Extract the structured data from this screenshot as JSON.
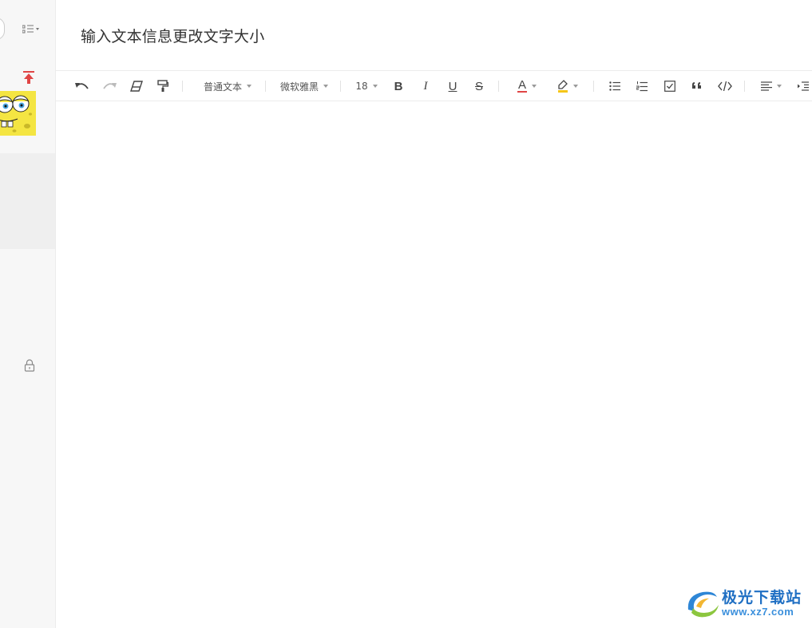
{
  "editor": {
    "title": "输入文本信息更改文字大小"
  },
  "toolbar": {
    "paragraph_style": "普通文本",
    "font_family": "微软雅黑",
    "font_size": "18",
    "bold_label": "B",
    "italic_label": "I",
    "underline_label": "U",
    "strike_label": "S",
    "font_color_label": "A",
    "font_color": "#e04545",
    "highlight_color": "#f5c518"
  },
  "icons": {
    "undo": "undo-icon",
    "redo": "redo-icon",
    "eraser": "eraser-icon",
    "format_painter": "format-painter-icon",
    "bullet_list": "bullet-list-icon",
    "numbered_list": "numbered-list-icon",
    "checkbox": "checkbox-icon",
    "quote": "quote-icon",
    "code": "code-icon",
    "align": "align-left-icon",
    "indent": "indent-icon",
    "pin_top": "pin-top-icon",
    "lock": "lock-icon"
  },
  "watermark": {
    "name": "极光下载站",
    "url": "www.xz7.com"
  },
  "colors": {
    "accent_red": "#e04545",
    "sidebar_bg": "#f7f7f7",
    "watermark_blue": "#1f6fc3"
  }
}
